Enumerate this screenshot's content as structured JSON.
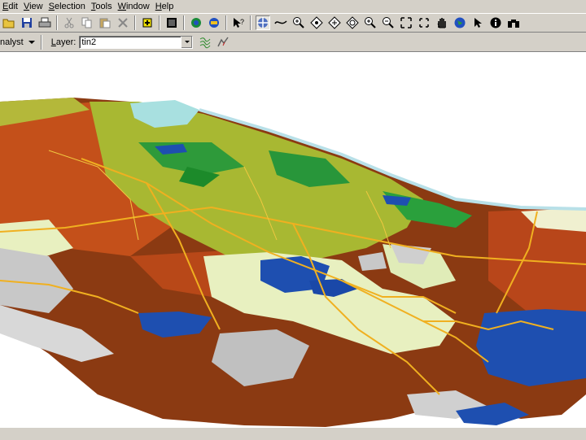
{
  "menu": {
    "items": [
      {
        "mnemonic": "E",
        "rest": "dit"
      },
      {
        "mnemonic": "V",
        "rest": "iew"
      },
      {
        "mnemonic": "S",
        "rest": "election"
      },
      {
        "mnemonic": "T",
        "rest": "ools"
      },
      {
        "mnemonic": "W",
        "rest": "indow"
      },
      {
        "mnemonic": "H",
        "rest": "elp"
      }
    ]
  },
  "toolbar": {
    "icons": [
      "open-icon",
      "save-icon",
      "print-icon",
      "cut-icon",
      "copy-icon",
      "paste-icon",
      "delete-icon",
      "add-data-icon",
      "full-extent-icon",
      "scene-properties-icon",
      "layers-icon",
      "whats-this-icon",
      "navigate-icon",
      "fly-icon",
      "zoom-in-out-icon",
      "target-icon",
      "zoom-to-target-icon",
      "set-observer-icon",
      "zoom-in-icon",
      "zoom-out-icon",
      "pan-icon",
      "full-extent-arrows-icon",
      "hand-icon",
      "globe-icon",
      "select-icon",
      "identify-icon",
      "binoculars-icon"
    ]
  },
  "analyst_toolbar": {
    "analyst_label": "nalyst",
    "layer_label_mnemonic": "L",
    "layer_label_rest": "ayer:",
    "layer_value": "tin2"
  },
  "colors": {
    "chrome": "#d4d0c8",
    "terrain_brown": "#8b3a12",
    "terrain_orange": "#c4501a",
    "vegetation_olive": "#a8b832",
    "vegetation_green": "#2e9a3a",
    "lake_blue": "#1e4fb0",
    "roads_yellow": "#f0b020",
    "peaks_gray": "#c8c8c8"
  }
}
